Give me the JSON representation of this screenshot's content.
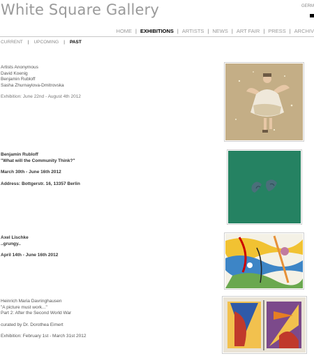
{
  "header": {
    "logo_text": "White Square Gallery",
    "lang_label": "GERM"
  },
  "mainnav": {
    "items": [
      {
        "label": "HOME"
      },
      {
        "label": "EXHIBITIONS"
      },
      {
        "label": "ARTISTS"
      },
      {
        "label": "NEWS"
      },
      {
        "label": "ART FAIR"
      },
      {
        "label": "PRESS"
      },
      {
        "label": "ARCHIV"
      }
    ],
    "active": "EXHIBITIONS",
    "sep": "|"
  },
  "subnav": {
    "items": [
      {
        "label": "CURRENT"
      },
      {
        "label": "UPCOMING"
      },
      {
        "label": "PAST"
      }
    ],
    "active": "PAST",
    "sep": "|"
  },
  "exhibitions": [
    {
      "lines": [
        "Artists Anonymous",
        "David Koenig",
        "Benjamin Rubloff",
        "Sasha Zhurnaylova-Dmitrovska"
      ],
      "date": "Exhibition: June 22nd - August 4th 2012",
      "image_icon": "painting-dancing-figure-icon"
    },
    {
      "artist": "Benjamin Rubloff",
      "title": "\"What will the Community Think?\"",
      "date": "March 30th - June 16th 2012",
      "address": "Address: Bottgerstr. 16, 13357 Berlin",
      "image_icon": "painting-green-shapes-icon"
    },
    {
      "artist": "Axel Lischke",
      "title": "..grungy..",
      "date": "April 14th - June 16th 2012",
      "image_icon": "painting-colorful-abstract-icon"
    },
    {
      "lines": [
        "Heinrich Maria Davringhausen",
        "\"A picture must work...\"",
        "Part 2: After the Second World War"
      ],
      "curator": "curated by Dr. Dorothea Eimert",
      "date": "Exhibition: February 1st - March 31st 2012",
      "image_icon": "painting-geometric-shapes-icon"
    }
  ],
  "colors": {
    "nav_active": "#000000",
    "nav_inactive": "#9a9a9a",
    "rule": "#c8c8c8"
  }
}
